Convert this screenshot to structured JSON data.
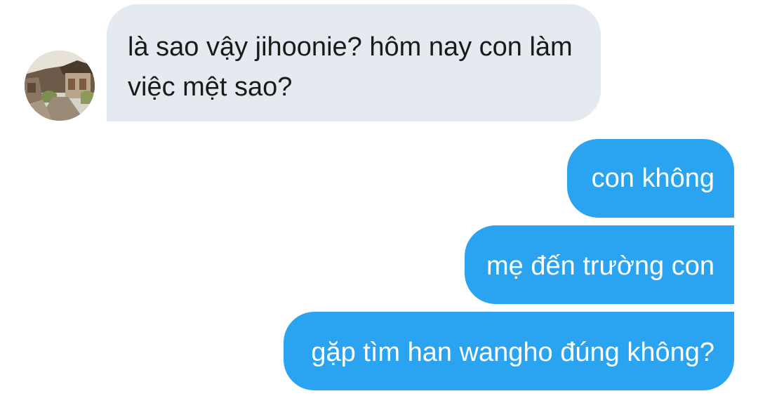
{
  "conversation": {
    "incoming": {
      "sender_avatar": "avatar-photo-hanok-street",
      "lines": [
        "là sao vậy jihoonie? hôm nay con làm",
        "việc mệt sao?"
      ]
    },
    "outgoing": [
      "con không",
      "mẹ đến trường con",
      "gặp tìm han wangho đúng không?"
    ]
  },
  "colors": {
    "incoming_bubble": "#e5eaf0",
    "outgoing_bubble": "#2aa3f0",
    "incoming_text": "#1a1a1a",
    "outgoing_text": "#ffffff"
  }
}
